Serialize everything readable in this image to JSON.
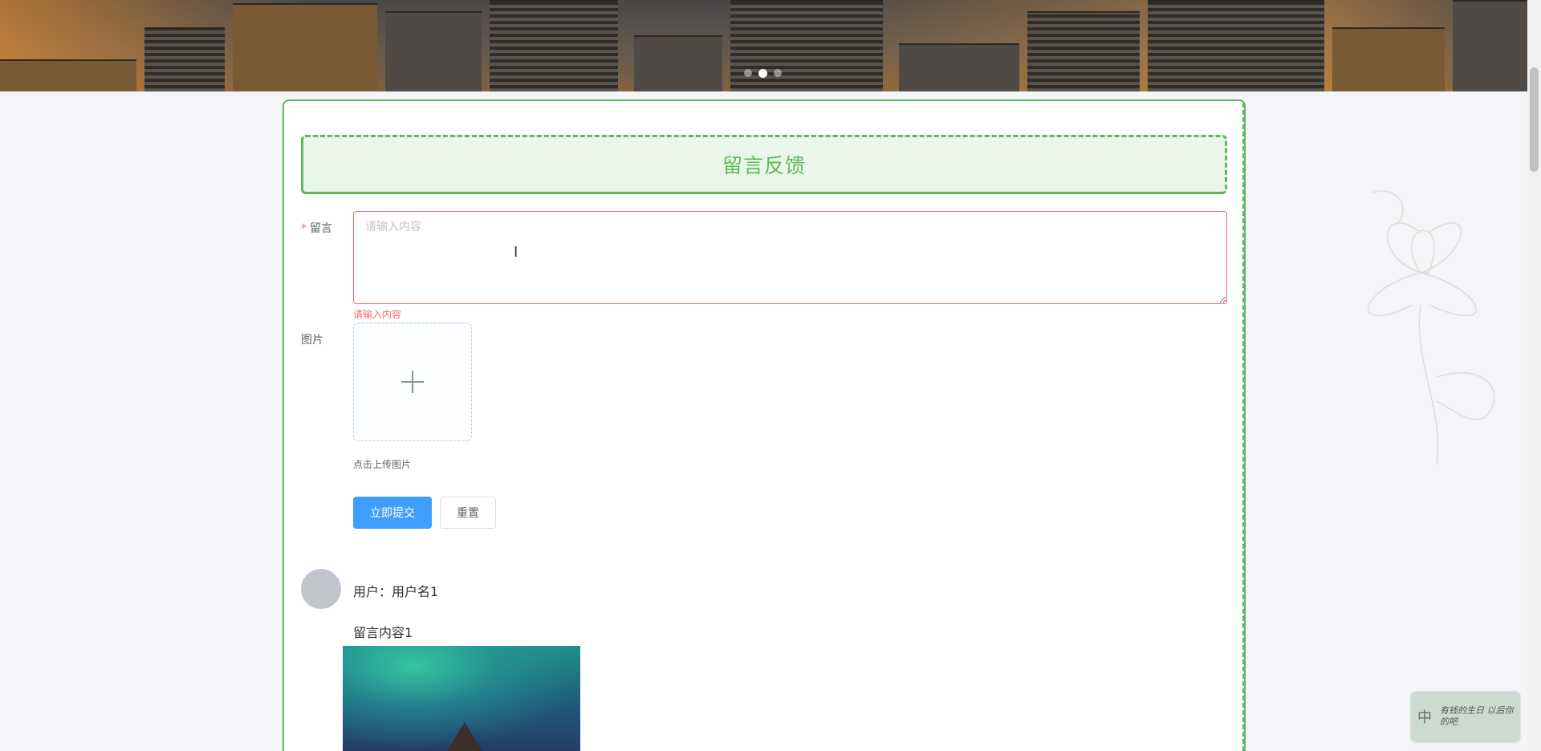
{
  "banner": {
    "slides": 3,
    "active_slide": 1
  },
  "form": {
    "title": "留言反馈",
    "message_label": "留言",
    "required_mark": "*",
    "message_placeholder": "请输入内容",
    "message_value": "",
    "message_error": "请输入内容",
    "image_label": "图片",
    "upload_tip": "点击上传图片",
    "submit_label": "立即提交",
    "reset_label": "重置"
  },
  "messages": [
    {
      "user": "用户：用户名1",
      "content": "留言内容1"
    }
  ],
  "ime": {
    "char": "中",
    "text": "有钱的生日 以后你的吧"
  },
  "colors": {
    "accent": "#5cb85c",
    "primary": "#409eff",
    "error": "#f56c6c"
  }
}
